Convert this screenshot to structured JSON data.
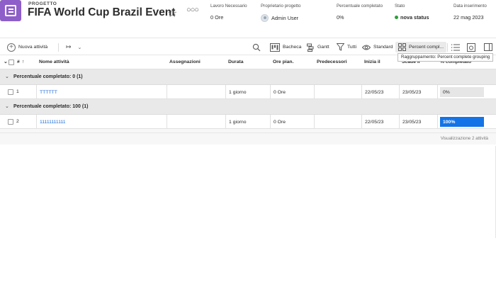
{
  "project": {
    "kicker": "PROGETTO",
    "title": "FIFA World Cup Brazil Event"
  },
  "meta": [
    {
      "label": "Lavoro Necessario",
      "value": "0 Ore"
    },
    {
      "label": "Proprietario progetto",
      "value": "Admin User"
    },
    {
      "label": "Percentuale completato",
      "value": "0%"
    },
    {
      "label": "Stato",
      "value": "nova status"
    },
    {
      "label": "Data inserimento",
      "value": "22 mag 2023"
    }
  ],
  "toolbar": {
    "new_task": "Nuova attività",
    "board": "Bacheca",
    "gantt": "Gantt",
    "filter": "Tutti",
    "view": "Standard",
    "grouping": "Percent compl...",
    "tooltip": "Raggruppamento: Percent complete grouping"
  },
  "columns": {
    "number": "#",
    "name": "Nome attività",
    "assignments": "Assegnazioni",
    "duration": "Durata",
    "planned_hours": "Ore pian.",
    "predecessors": "Predecessori",
    "start": "Inizia il",
    "end": "Scade il",
    "percent": "% completato"
  },
  "groups": [
    {
      "title": "Percentuale completato: 0 (1)",
      "rows": [
        {
          "num": "1",
          "name": "TTTTTT",
          "duration": "1 giorno",
          "hours": "0 Ore",
          "start": "22/05/23",
          "end": "23/05/23",
          "percent": "0%"
        }
      ]
    },
    {
      "title": "Percentuale completato: 100 (1)",
      "rows": [
        {
          "num": "2",
          "name": "11111111111",
          "duration": "1 giorno",
          "hours": "0 Ore",
          "start": "22/05/23",
          "end": "23/05/23",
          "percent": "100%"
        }
      ]
    }
  ],
  "footer": "Visualizzazione 2 attività",
  "colors": {
    "accent": "#1473e6",
    "project_icon": "#8e5fc8",
    "status_dot": "#2d9d3a"
  }
}
